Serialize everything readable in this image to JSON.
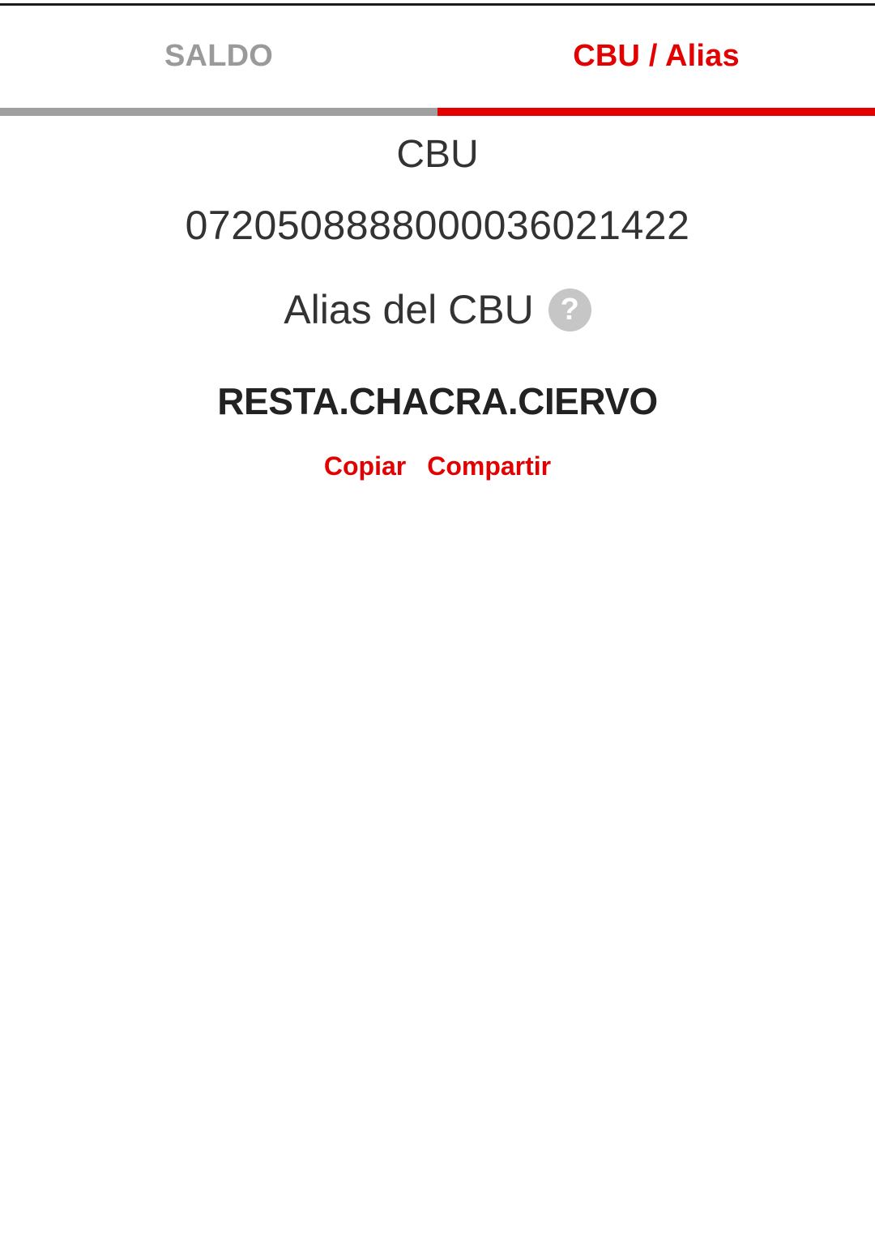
{
  "tabs": [
    {
      "label": "SALDO",
      "active": false
    },
    {
      "label": "CBU / Alias",
      "active": true
    }
  ],
  "cbu": {
    "title": "CBU",
    "number": "0720508888000036021422"
  },
  "alias": {
    "title": "Alias del CBU",
    "help_icon": "question-circle-icon",
    "help_symbol": "?",
    "value": "RESTA.CHACRA.CIERVO"
  },
  "actions": {
    "copy_label": "Copiar",
    "share_label": "Compartir"
  },
  "colors": {
    "accent": "#e30000",
    "inactive_tab": "#9a9a9a",
    "text": "#333333",
    "help_icon_bg": "#c6c6c6"
  }
}
